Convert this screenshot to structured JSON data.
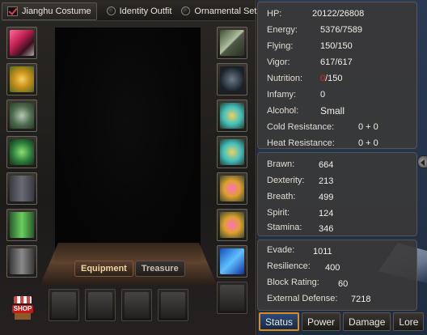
{
  "outfit_tabs": {
    "jianghu": "Jianghu Costume",
    "identity": "Identity Outfit",
    "ornamental": "Ornamental Set"
  },
  "mode_tabs": {
    "equipment": "Equipment",
    "treasure": "Treasure"
  },
  "shop_label": "SHOP",
  "left_slots": [
    "hat",
    "gold-ornament",
    "armor",
    "gloves",
    "pants",
    "leggings",
    "boots"
  ],
  "right_slots": [
    "weapon-rod",
    "dark-item",
    "wing-charm-1",
    "wing-charm-2",
    "ring-1",
    "ring-2",
    "book",
    "empty"
  ],
  "bottom_slots": [
    "empty-hat",
    "empty-robe",
    "empty-leg",
    "empty-figure"
  ],
  "stats_general": [
    {
      "label": "HP:",
      "value": "20122/26808"
    },
    {
      "label": "Energy:",
      "value": "5376/7589"
    },
    {
      "label": "Flying:",
      "value": "150/150"
    },
    {
      "label": "Vigor:",
      "value": "617/617"
    },
    {
      "label": "Nutrition:",
      "value_red": "0",
      "value": "/150"
    },
    {
      "label": "Infamy:",
      "value": "0"
    },
    {
      "label": "Alcohol:",
      "value": "Small"
    },
    {
      "label": "Cold Resistance:",
      "value": "0 + 0"
    },
    {
      "label": "Heat Resistance:",
      "value": "0 + 0"
    }
  ],
  "stats_attributes": [
    {
      "label": "Brawn:",
      "value": "664"
    },
    {
      "label": "Dexterity:",
      "value": "213"
    },
    {
      "label": "Breath:",
      "value": "499"
    },
    {
      "label": "Spirit:",
      "value": "124"
    },
    {
      "label": "Stamina:",
      "value": "346"
    }
  ],
  "stats_defense": [
    {
      "label": "Evade:",
      "value": "1011"
    },
    {
      "label": "Resilience:",
      "value": "400"
    },
    {
      "label": "Block Rating:",
      "value": "60"
    },
    {
      "label": "External Defense:",
      "value": "7218"
    }
  ],
  "bottom_tabs": [
    "Status",
    "Power",
    "Damage",
    "Lore"
  ],
  "active_bottom_tab": "Status"
}
